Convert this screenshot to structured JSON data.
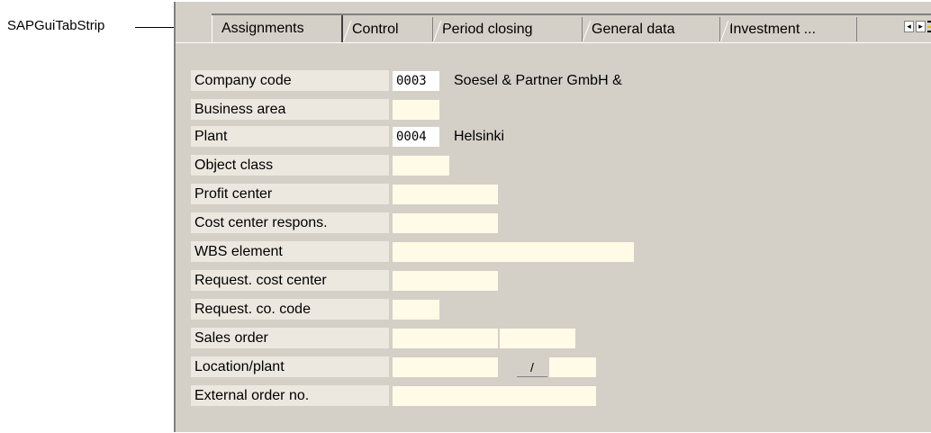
{
  "callout": {
    "label": "SAPGuiTabStrip"
  },
  "tabs": [
    {
      "label": "Assignments",
      "active": true
    },
    {
      "label": "Control",
      "active": false
    },
    {
      "label": "Period closing",
      "active": false
    },
    {
      "label": "General data",
      "active": false
    },
    {
      "label": "Investment ...",
      "active": false
    }
  ],
  "tab_arrows": {
    "left": "◂",
    "right": "▸"
  },
  "fields": [
    {
      "label": "Company code",
      "value": "0003",
      "description": "Soesel & Partner GmbH &"
    },
    {
      "label": "Business area",
      "value": ""
    },
    {
      "label": "Plant",
      "value": "0004",
      "description": "Helsinki"
    },
    {
      "label": "Object class",
      "value": ""
    },
    {
      "label": "Profit center",
      "value": ""
    },
    {
      "label": "Cost center respons.",
      "value": ""
    },
    {
      "label": "WBS element",
      "value": ""
    },
    {
      "label": "Request. cost center",
      "value": ""
    },
    {
      "label": "Request. co. code",
      "value": ""
    },
    {
      "label": "Sales order",
      "value": "",
      "value2": ""
    },
    {
      "label": "Location/plant",
      "value": "",
      "separator": "/",
      "value2": ""
    },
    {
      "label": "External order no.",
      "value": ""
    }
  ],
  "colors": {
    "panel": "#d4d0c8",
    "input": "#fffbe6",
    "label_bg": "#ece8e0"
  }
}
